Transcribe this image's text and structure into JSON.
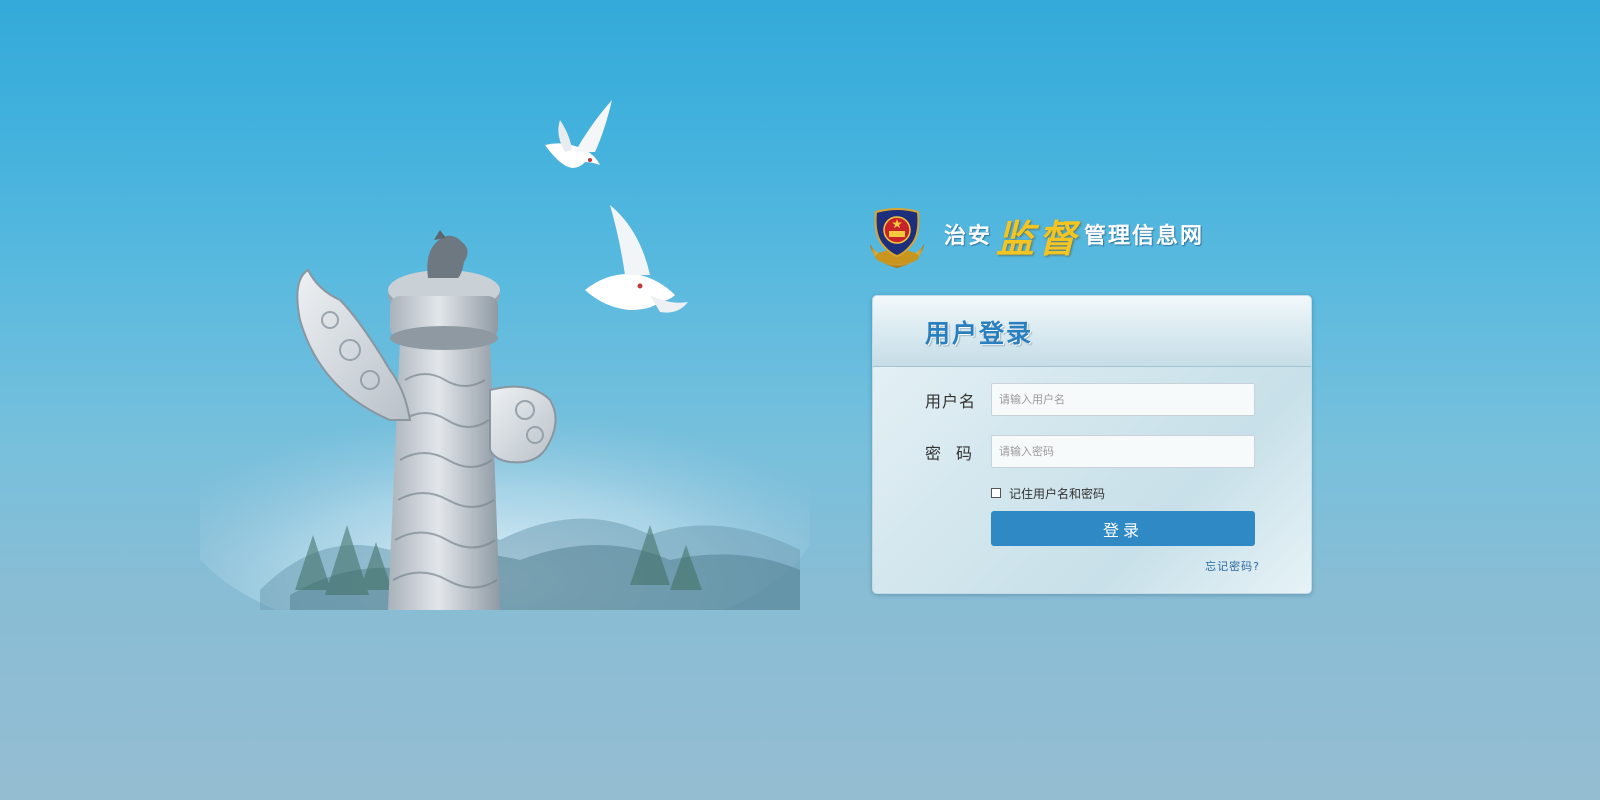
{
  "site": {
    "title_part1": "治安",
    "title_part2": "监督",
    "title_part3": "管理信息网",
    "emblem_icon": "police-emblem-icon"
  },
  "login": {
    "title": "用户登录",
    "username_label": "用户名",
    "username_placeholder": "请输入用户名",
    "password_label": "密码",
    "password_placeholder": "请输入密码",
    "remember_label": "记住用户名和密码",
    "submit_label": "登录",
    "forgot_label": "忘记密码?"
  },
  "colors": {
    "accent": "#2e89c5",
    "title_highlight": "#f2c522",
    "card_title": "#2a7fbf"
  },
  "decoration": {
    "illustration_icon": "huabiao-column-with-doves"
  }
}
